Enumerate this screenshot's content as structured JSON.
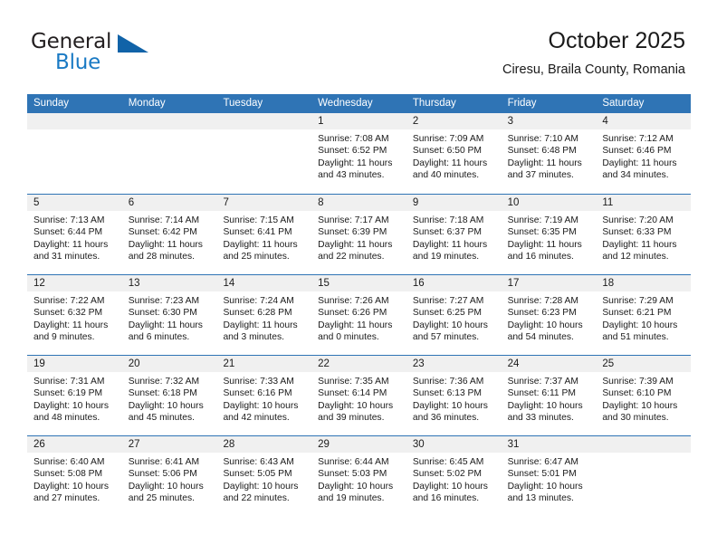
{
  "brand": {
    "line1": "General",
    "line2": "Blue",
    "triangle_icon": "triangle-logo-icon",
    "colors": {
      "blue": "#1a7ac4",
      "dark_blue": "#1163a8",
      "black": "#231f20"
    }
  },
  "header": {
    "title": "October 2025",
    "location": "Ciresu, Braila County, Romania"
  },
  "theme": {
    "header_blue": "#2f74b5",
    "date_band": "#f0f0f0",
    "text": "#1a1a1a"
  },
  "weekdays": [
    "Sunday",
    "Monday",
    "Tuesday",
    "Wednesday",
    "Thursday",
    "Friday",
    "Saturday"
  ],
  "labels": {
    "sunrise_prefix": "Sunrise: ",
    "sunset_prefix": "Sunset: ",
    "daylight_prefix": "Daylight: "
  },
  "weeks": [
    [
      {
        "empty": true
      },
      {
        "empty": true
      },
      {
        "empty": true
      },
      {
        "day": "1",
        "sunrise": "Sunrise: 7:08 AM",
        "sunset": "Sunset: 6:52 PM",
        "daylight": "Daylight: 11 hours and 43 minutes."
      },
      {
        "day": "2",
        "sunrise": "Sunrise: 7:09 AM",
        "sunset": "Sunset: 6:50 PM",
        "daylight": "Daylight: 11 hours and 40 minutes."
      },
      {
        "day": "3",
        "sunrise": "Sunrise: 7:10 AM",
        "sunset": "Sunset: 6:48 PM",
        "daylight": "Daylight: 11 hours and 37 minutes."
      },
      {
        "day": "4",
        "sunrise": "Sunrise: 7:12 AM",
        "sunset": "Sunset: 6:46 PM",
        "daylight": "Daylight: 11 hours and 34 minutes."
      }
    ],
    [
      {
        "day": "5",
        "sunrise": "Sunrise: 7:13 AM",
        "sunset": "Sunset: 6:44 PM",
        "daylight": "Daylight: 11 hours and 31 minutes."
      },
      {
        "day": "6",
        "sunrise": "Sunrise: 7:14 AM",
        "sunset": "Sunset: 6:42 PM",
        "daylight": "Daylight: 11 hours and 28 minutes."
      },
      {
        "day": "7",
        "sunrise": "Sunrise: 7:15 AM",
        "sunset": "Sunset: 6:41 PM",
        "daylight": "Daylight: 11 hours and 25 minutes."
      },
      {
        "day": "8",
        "sunrise": "Sunrise: 7:17 AM",
        "sunset": "Sunset: 6:39 PM",
        "daylight": "Daylight: 11 hours and 22 minutes."
      },
      {
        "day": "9",
        "sunrise": "Sunrise: 7:18 AM",
        "sunset": "Sunset: 6:37 PM",
        "daylight": "Daylight: 11 hours and 19 minutes."
      },
      {
        "day": "10",
        "sunrise": "Sunrise: 7:19 AM",
        "sunset": "Sunset: 6:35 PM",
        "daylight": "Daylight: 11 hours and 16 minutes."
      },
      {
        "day": "11",
        "sunrise": "Sunrise: 7:20 AM",
        "sunset": "Sunset: 6:33 PM",
        "daylight": "Daylight: 11 hours and 12 minutes."
      }
    ],
    [
      {
        "day": "12",
        "sunrise": "Sunrise: 7:22 AM",
        "sunset": "Sunset: 6:32 PM",
        "daylight": "Daylight: 11 hours and 9 minutes."
      },
      {
        "day": "13",
        "sunrise": "Sunrise: 7:23 AM",
        "sunset": "Sunset: 6:30 PM",
        "daylight": "Daylight: 11 hours and 6 minutes."
      },
      {
        "day": "14",
        "sunrise": "Sunrise: 7:24 AM",
        "sunset": "Sunset: 6:28 PM",
        "daylight": "Daylight: 11 hours and 3 minutes."
      },
      {
        "day": "15",
        "sunrise": "Sunrise: 7:26 AM",
        "sunset": "Sunset: 6:26 PM",
        "daylight": "Daylight: 11 hours and 0 minutes."
      },
      {
        "day": "16",
        "sunrise": "Sunrise: 7:27 AM",
        "sunset": "Sunset: 6:25 PM",
        "daylight": "Daylight: 10 hours and 57 minutes."
      },
      {
        "day": "17",
        "sunrise": "Sunrise: 7:28 AM",
        "sunset": "Sunset: 6:23 PM",
        "daylight": "Daylight: 10 hours and 54 minutes."
      },
      {
        "day": "18",
        "sunrise": "Sunrise: 7:29 AM",
        "sunset": "Sunset: 6:21 PM",
        "daylight": "Daylight: 10 hours and 51 minutes."
      }
    ],
    [
      {
        "day": "19",
        "sunrise": "Sunrise: 7:31 AM",
        "sunset": "Sunset: 6:19 PM",
        "daylight": "Daylight: 10 hours and 48 minutes."
      },
      {
        "day": "20",
        "sunrise": "Sunrise: 7:32 AM",
        "sunset": "Sunset: 6:18 PM",
        "daylight": "Daylight: 10 hours and 45 minutes."
      },
      {
        "day": "21",
        "sunrise": "Sunrise: 7:33 AM",
        "sunset": "Sunset: 6:16 PM",
        "daylight": "Daylight: 10 hours and 42 minutes."
      },
      {
        "day": "22",
        "sunrise": "Sunrise: 7:35 AM",
        "sunset": "Sunset: 6:14 PM",
        "daylight": "Daylight: 10 hours and 39 minutes."
      },
      {
        "day": "23",
        "sunrise": "Sunrise: 7:36 AM",
        "sunset": "Sunset: 6:13 PM",
        "daylight": "Daylight: 10 hours and 36 minutes."
      },
      {
        "day": "24",
        "sunrise": "Sunrise: 7:37 AM",
        "sunset": "Sunset: 6:11 PM",
        "daylight": "Daylight: 10 hours and 33 minutes."
      },
      {
        "day": "25",
        "sunrise": "Sunrise: 7:39 AM",
        "sunset": "Sunset: 6:10 PM",
        "daylight": "Daylight: 10 hours and 30 minutes."
      }
    ],
    [
      {
        "day": "26",
        "sunrise": "Sunrise: 6:40 AM",
        "sunset": "Sunset: 5:08 PM",
        "daylight": "Daylight: 10 hours and 27 minutes."
      },
      {
        "day": "27",
        "sunrise": "Sunrise: 6:41 AM",
        "sunset": "Sunset: 5:06 PM",
        "daylight": "Daylight: 10 hours and 25 minutes."
      },
      {
        "day": "28",
        "sunrise": "Sunrise: 6:43 AM",
        "sunset": "Sunset: 5:05 PM",
        "daylight": "Daylight: 10 hours and 22 minutes."
      },
      {
        "day": "29",
        "sunrise": "Sunrise: 6:44 AM",
        "sunset": "Sunset: 5:03 PM",
        "daylight": "Daylight: 10 hours and 19 minutes."
      },
      {
        "day": "30",
        "sunrise": "Sunrise: 6:45 AM",
        "sunset": "Sunset: 5:02 PM",
        "daylight": "Daylight: 10 hours and 16 minutes."
      },
      {
        "day": "31",
        "sunrise": "Sunrise: 6:47 AM",
        "sunset": "Sunset: 5:01 PM",
        "daylight": "Daylight: 10 hours and 13 minutes."
      },
      {
        "empty": true
      }
    ]
  ]
}
